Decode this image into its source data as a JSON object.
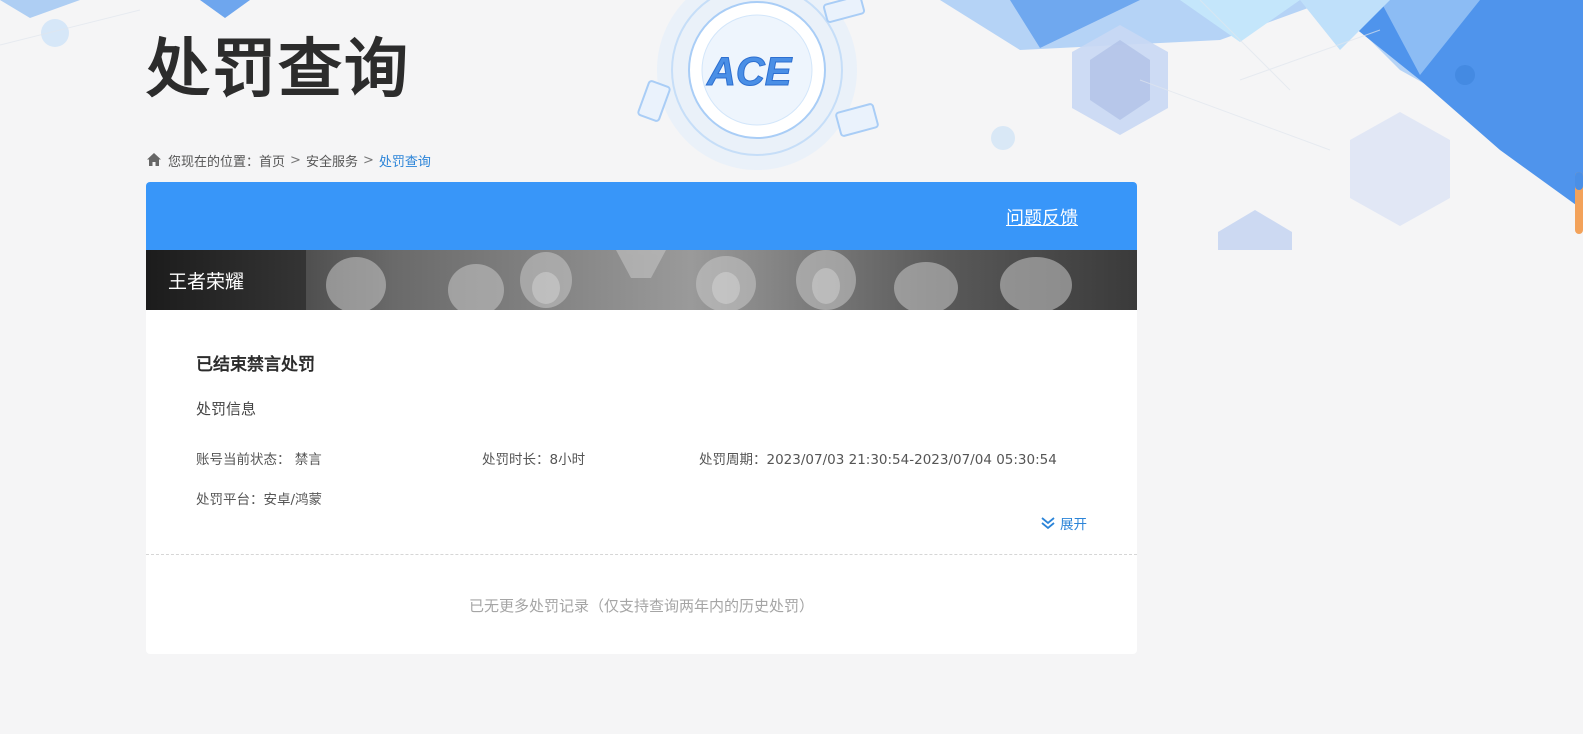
{
  "header": {
    "title": "处罚查询",
    "logo_text": "ACE"
  },
  "breadcrumb": {
    "prefix": "您现在的位置：",
    "items": [
      "首页",
      "安全服务",
      "处罚查询"
    ],
    "separator": ">"
  },
  "card": {
    "feedback_label": "问题反馈",
    "game_name": "王者荣耀",
    "record": {
      "title": "已结束禁言处罚",
      "section_label": "处罚信息",
      "status": "账号当前状态： 禁言",
      "duration": "处罚时长：8小时",
      "period": "处罚周期：2023/07/03 21:30:54-2023/07/04 05:30:54",
      "platform": "处罚平台：安卓/鸿蒙",
      "expand_label": "展开"
    },
    "end_note": "已无更多处罚记录（仅支持查询两年内的历史处罚）"
  },
  "colors": {
    "accent": "#3896f9",
    "link": "#2b84d8",
    "title": "#2c2c2c",
    "background": "#f5f5f6"
  },
  "icons": {
    "home": "home-icon",
    "expand": "double-chevron-down-icon",
    "logo": "ace-logo"
  }
}
